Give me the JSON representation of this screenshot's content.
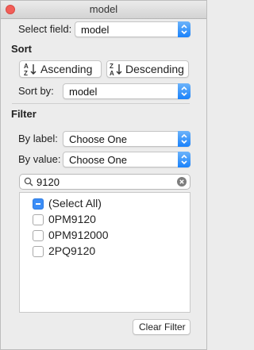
{
  "window": {
    "title": "model"
  },
  "select_field": {
    "label": "Select field:",
    "value": "model"
  },
  "sort": {
    "heading": "Sort",
    "ascending_label": "Ascending",
    "descending_label": "Descending",
    "sort_by_label": "Sort by:",
    "sort_by_value": "model"
  },
  "filter": {
    "heading": "Filter",
    "by_label": {
      "label": "By label:",
      "value": "Choose One"
    },
    "by_value": {
      "label": "By value:",
      "value": "Choose One"
    }
  },
  "search": {
    "value": "9120"
  },
  "items": [
    {
      "label": "(Select All)",
      "state": "mixed"
    },
    {
      "label": "0PM9120",
      "state": "unchecked"
    },
    {
      "label": "0PM912000",
      "state": "unchecked"
    },
    {
      "label": "2PQ9120",
      "state": "unchecked"
    }
  ],
  "clear_filter_label": "Clear Filter",
  "colors": {
    "accent": "#1a82fb",
    "close": "#f25e58"
  }
}
